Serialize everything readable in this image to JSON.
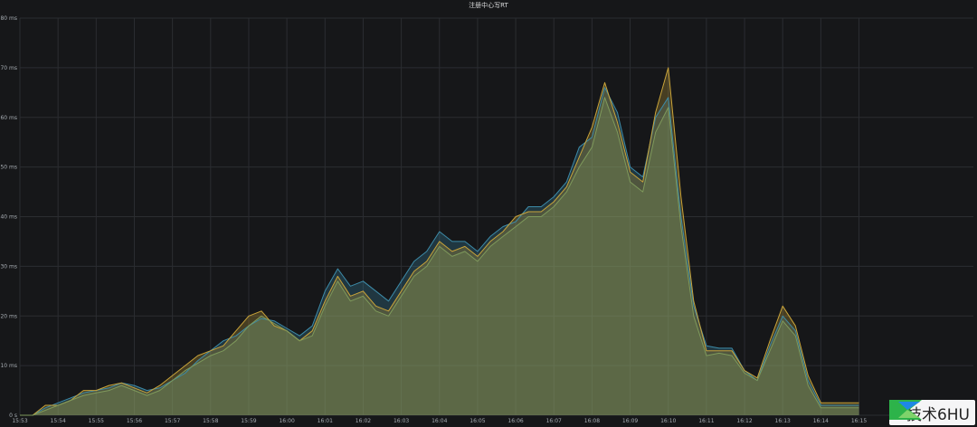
{
  "chart_data": {
    "type": "area",
    "title": "注册中心写RT",
    "xlabel": "",
    "ylabel": "",
    "y_unit": "ms",
    "ylim": [
      0,
      80
    ],
    "y_ticks": [
      "0 s",
      "10 ms",
      "20 ms",
      "30 ms",
      "40 ms",
      "50 ms",
      "60 ms",
      "70 ms",
      "80 ms"
    ],
    "x_ticks": [
      "15:53",
      "15:54",
      "15:55",
      "15:56",
      "15:57",
      "15:58",
      "15:59",
      "16:00",
      "16:01",
      "16:02",
      "16:03",
      "16:04",
      "16:05",
      "16:06",
      "16:07",
      "16:08",
      "16:09",
      "16:10",
      "16:11",
      "16:12",
      "16:13",
      "16:14",
      "16:15"
    ],
    "x_start": "15:53",
    "x_end": "16:18",
    "grid": true,
    "legend": "none",
    "series": [
      {
        "color": "#3d8ba8",
        "t": [
          "15:53:00",
          "15:53:20",
          "15:53:40",
          "15:54:00",
          "15:54:20",
          "15:54:40",
          "15:55:00",
          "15:55:20",
          "15:55:40",
          "15:56:00",
          "15:56:20",
          "15:56:40",
          "15:57:00",
          "15:57:20",
          "15:57:40",
          "15:58:00",
          "15:58:20",
          "15:58:40",
          "15:59:00",
          "15:59:20",
          "15:59:40",
          "16:00:00",
          "16:00:20",
          "16:00:40",
          "16:01:00",
          "16:01:20",
          "16:01:40",
          "16:02:00",
          "16:02:20",
          "16:02:40",
          "16:03:00",
          "16:03:20",
          "16:03:40",
          "16:04:00",
          "16:04:20",
          "16:04:40",
          "16:05:00",
          "16:05:20",
          "16:05:40",
          "16:06:00",
          "16:06:20",
          "16:06:40",
          "16:07:00",
          "16:07:20",
          "16:07:40",
          "16:08:00",
          "16:08:20",
          "16:08:40",
          "16:09:00",
          "16:09:20",
          "16:09:40",
          "16:10:00",
          "16:10:20",
          "16:10:40",
          "16:11:00",
          "16:11:20",
          "16:11:40",
          "16:12:00",
          "16:12:20",
          "16:12:40",
          "16:13:00",
          "16:13:20",
          "16:13:40",
          "16:14:00",
          "16:14:20",
          "16:14:40",
          "16:15:00"
        ],
        "values": [
          0,
          0,
          1.5,
          2.5,
          3.5,
          4.5,
          5,
          5.5,
          6.5,
          6,
          5,
          5.5,
          7,
          8.5,
          11,
          13,
          15,
          16,
          18,
          19.5,
          19,
          17.5,
          16,
          18,
          25,
          29.5,
          26,
          27,
          25,
          23,
          27,
          31,
          33,
          37,
          35,
          35,
          33,
          36,
          38,
          39,
          42,
          42,
          44,
          47,
          54,
          56,
          66,
          61,
          50,
          48,
          60,
          64,
          40,
          22,
          14,
          13.5,
          13.5,
          9,
          7,
          14,
          20,
          17,
          7,
          2,
          2,
          2,
          2
        ]
      },
      {
        "color": "#c9a43a",
        "t": [
          "15:53:00",
          "15:53:20",
          "15:53:40",
          "15:54:00",
          "15:54:20",
          "15:54:40",
          "15:55:00",
          "15:55:20",
          "15:55:40",
          "15:56:00",
          "15:56:20",
          "15:56:40",
          "15:57:00",
          "15:57:20",
          "15:57:40",
          "15:58:00",
          "15:58:20",
          "15:58:40",
          "15:59:00",
          "15:59:20",
          "15:59:40",
          "16:00:00",
          "16:00:20",
          "16:00:40",
          "16:01:00",
          "16:01:20",
          "16:01:40",
          "16:02:00",
          "16:02:20",
          "16:02:40",
          "16:03:00",
          "16:03:20",
          "16:03:40",
          "16:04:00",
          "16:04:20",
          "16:04:40",
          "16:05:00",
          "16:05:20",
          "16:05:40",
          "16:06:00",
          "16:06:20",
          "16:06:40",
          "16:07:00",
          "16:07:20",
          "16:07:40",
          "16:08:00",
          "16:08:20",
          "16:08:40",
          "16:09:00",
          "16:09:20",
          "16:09:40",
          "16:10:00",
          "16:10:20",
          "16:10:40",
          "16:11:00",
          "16:11:20",
          "16:11:40",
          "16:12:00",
          "16:12:20",
          "16:12:40",
          "16:13:00",
          "16:13:20",
          "16:13:40",
          "16:14:00",
          "16:14:20",
          "16:14:40",
          "16:15:00"
        ],
        "values": [
          0,
          0,
          2,
          2,
          3,
          5,
          5,
          6,
          6.5,
          5.5,
          4.5,
          6,
          8,
          10,
          12,
          13,
          14,
          17,
          20,
          21,
          18,
          17,
          15,
          17,
          23,
          28,
          24,
          25,
          22,
          21,
          25,
          29,
          31,
          35,
          33,
          34,
          32,
          35,
          37,
          40,
          41,
          41,
          43,
          46,
          52,
          58,
          67,
          59,
          49,
          47,
          61,
          70,
          44,
          23,
          13,
          13,
          13,
          9,
          7.5,
          15,
          22,
          18,
          8,
          2.5,
          2.5,
          2.5,
          2.5
        ]
      },
      {
        "color": "#7f9a5c",
        "t": [
          "15:53:00",
          "15:53:20",
          "15:53:40",
          "15:54:00",
          "15:54:20",
          "15:54:40",
          "15:55:00",
          "15:55:20",
          "15:55:40",
          "15:56:00",
          "15:56:20",
          "15:56:40",
          "15:57:00",
          "15:57:20",
          "15:57:40",
          "15:58:00",
          "15:58:20",
          "15:58:40",
          "15:59:00",
          "15:59:20",
          "15:59:40",
          "16:00:00",
          "16:00:20",
          "16:00:40",
          "16:01:00",
          "16:01:20",
          "16:01:40",
          "16:02:00",
          "16:02:20",
          "16:02:40",
          "16:03:00",
          "16:03:20",
          "16:03:40",
          "16:04:00",
          "16:04:20",
          "16:04:40",
          "16:05:00",
          "16:05:20",
          "16:05:40",
          "16:06:00",
          "16:06:20",
          "16:06:40",
          "16:07:00",
          "16:07:20",
          "16:07:40",
          "16:08:00",
          "16:08:20",
          "16:08:40",
          "16:09:00",
          "16:09:20",
          "16:09:40",
          "16:10:00",
          "16:10:20",
          "16:10:40",
          "16:11:00",
          "16:11:20",
          "16:11:40",
          "16:12:00",
          "16:12:20",
          "16:12:40",
          "16:13:00",
          "16:13:20",
          "16:13:40",
          "16:14:00",
          "16:14:20",
          "16:14:40",
          "16:15:00"
        ],
        "values": [
          0,
          0,
          1,
          2,
          3,
          4,
          4.5,
          5,
          6,
          5,
          4,
          5,
          7,
          9,
          10.5,
          12,
          13,
          15,
          18,
          20,
          18.5,
          17,
          15,
          16,
          22,
          27,
          23,
          24,
          21,
          20,
          24,
          28,
          30,
          34,
          32,
          33,
          31,
          34,
          36,
          38,
          40,
          40,
          42,
          45,
          50,
          54,
          64,
          57,
          47,
          45,
          57,
          62,
          38,
          20,
          12,
          12.5,
          12,
          8.5,
          7,
          13,
          19,
          16,
          6,
          1.5,
          1.5,
          1.5,
          1.5
        ]
      }
    ]
  },
  "watermark": {
    "text": "IT技术6HU"
  }
}
